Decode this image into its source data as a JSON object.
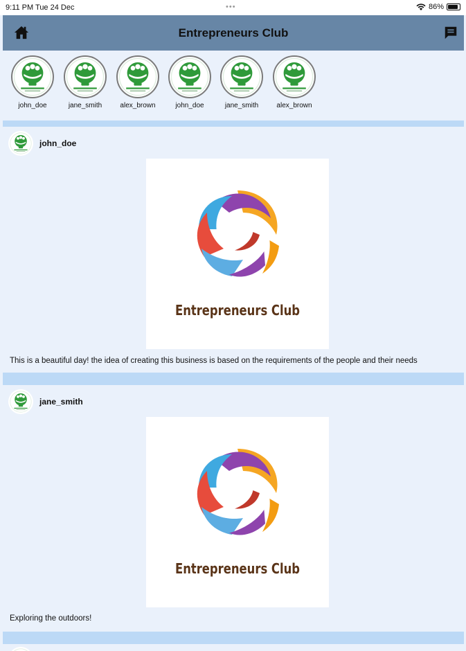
{
  "status_bar": {
    "time": "9:11 PM  Tue 24 Dec",
    "dots": "•••",
    "battery": "86%"
  },
  "header": {
    "title": "Entrepreneurs Club",
    "home_icon": "home-icon",
    "chat_icon": "chat-icon"
  },
  "stories": [
    {
      "name": "john_doe"
    },
    {
      "name": "jane_smith"
    },
    {
      "name": "alex_brown"
    },
    {
      "name": "john_doe"
    },
    {
      "name": "jane_smith"
    },
    {
      "name": "alex_brown"
    }
  ],
  "posts": [
    {
      "username": "john_doe",
      "image_brand": "Entrepreneurs Club",
      "caption": "This is a beautiful day! the idea of creating this business is based on the requirements of the people and their needs"
    },
    {
      "username": "jane_smith",
      "image_brand": "Entrepreneurs Club",
      "caption": "Exploring the outdoors!"
    }
  ],
  "colors": {
    "header_bg": "#6786a6",
    "page_bg": "#eaf1fb",
    "separator": "#bcd9f6",
    "logo_green": "#2f9a3a",
    "brand_text": "#5a3418"
  }
}
